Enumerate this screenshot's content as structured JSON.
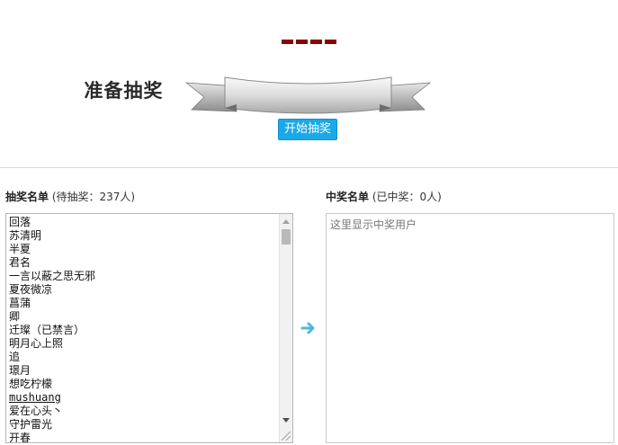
{
  "header": {
    "banner_text": "准备抽奖",
    "start_button": "开始抽奖"
  },
  "left_panel": {
    "title": "抽奖名单",
    "count_text": "(待抽奖：237人)",
    "names": [
      "回落",
      "苏清明",
      "半夏",
      "君名",
      "一言以蔽之思无邪",
      "夏夜微凉",
      "菖蒲",
      "卿",
      "迁璨（已禁言）",
      "明月心上照",
      "追",
      "璟月",
      "想吃柠檬",
      "mushuang",
      "爱在心头丶",
      "守护雷光",
      "开春"
    ]
  },
  "right_panel": {
    "title": "中奖名单",
    "count_text": "(已中奖：0人)",
    "placeholder": "这里显示中奖用户"
  },
  "colors": {
    "accent_button": "#1aa8e8",
    "dash": "#8b0000",
    "arrow": "#4cb8e0"
  }
}
